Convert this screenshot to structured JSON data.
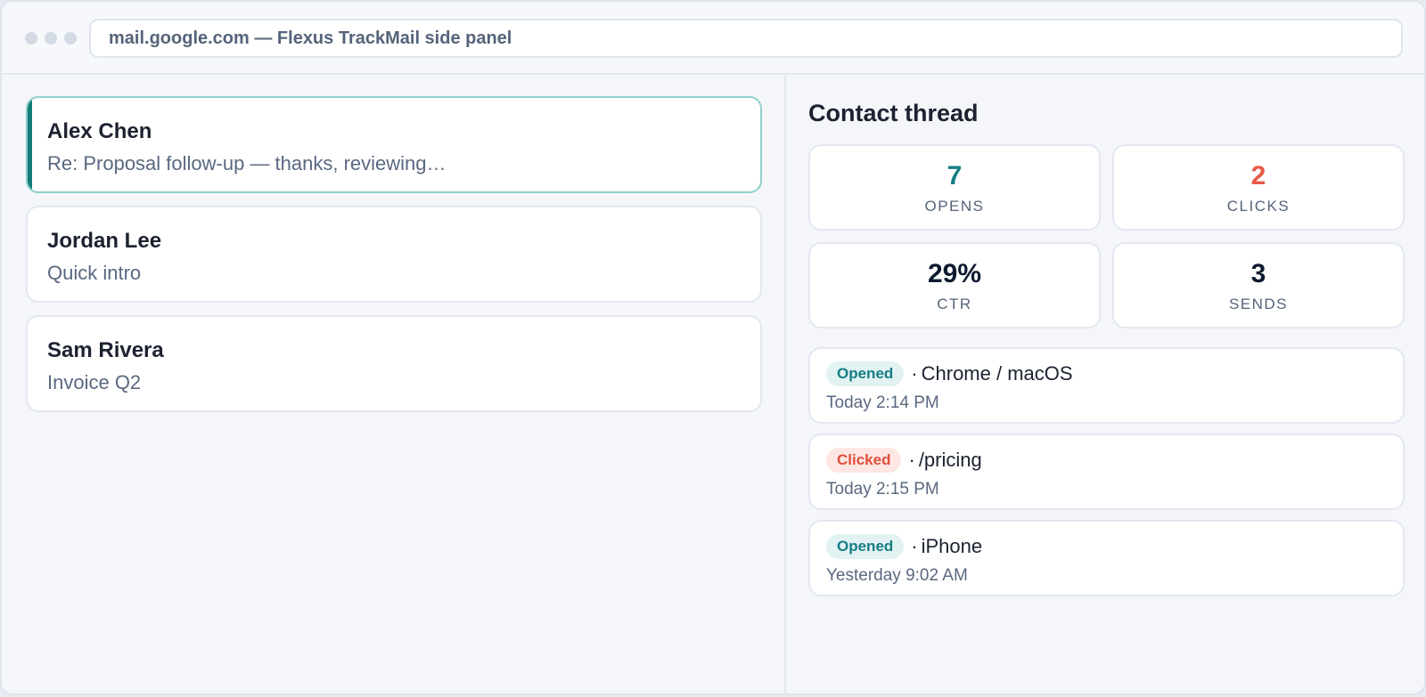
{
  "window": {
    "url_title": "mail.google.com — Flexus TrackMail side panel"
  },
  "emails": [
    {
      "sender": "Alex Chen",
      "subject": "Re: Proposal follow-up — thanks, reviewing…",
      "selected": true
    },
    {
      "sender": "Jordan Lee",
      "subject": "Quick intro",
      "selected": false
    },
    {
      "sender": "Sam Rivera",
      "subject": "Invoice Q2",
      "selected": false
    }
  ],
  "panel": {
    "title": "Contact thread",
    "stats": [
      {
        "value": "7",
        "label": "OPENS",
        "color": "#157e83"
      },
      {
        "value": "2",
        "label": "CLICKS",
        "color": "#e85a47"
      },
      {
        "value": "29%",
        "label": "CTR",
        "color": "#0e1a2e"
      },
      {
        "value": "3",
        "label": "SENDS",
        "color": "#0e1a2e"
      }
    ],
    "events": [
      {
        "badge": "Opened",
        "type": "opened",
        "separator": "·",
        "detail": "Chrome / macOS",
        "time": "Today 2:14 PM"
      },
      {
        "badge": "Clicked",
        "type": "clicked",
        "separator": "·",
        "detail": "/pricing",
        "time": "Today 2:15 PM"
      },
      {
        "badge": "Opened",
        "type": "opened",
        "separator": "·",
        "detail": "iPhone",
        "time": "Yesterday 9:02 AM"
      }
    ]
  },
  "colors": {
    "accent_teal": "#157e83",
    "accent_red": "#e85a47",
    "selected_bar": "#137c78"
  }
}
